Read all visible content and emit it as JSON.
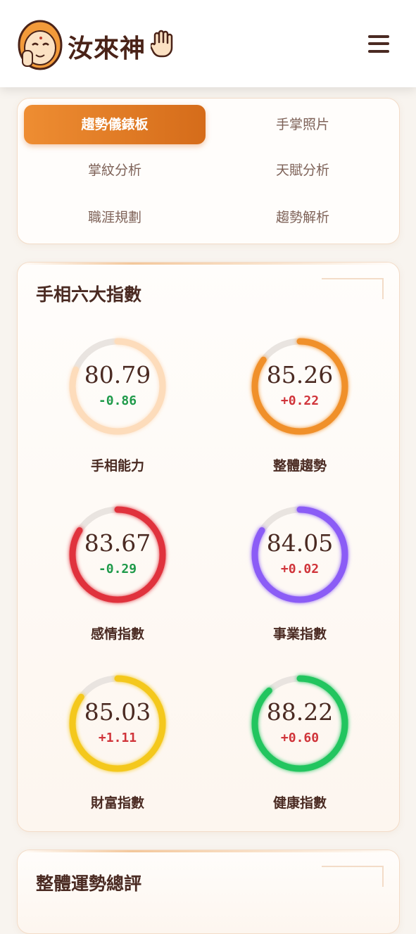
{
  "header": {
    "logo_text": "汝來神",
    "menu_icon": "hamburger-menu-icon"
  },
  "tabs": [
    {
      "label": "趨勢儀錶板",
      "active": true
    },
    {
      "label": "手掌照片",
      "active": false
    },
    {
      "label": "掌紋分析",
      "active": false
    },
    {
      "label": "天賦分析",
      "active": false
    },
    {
      "label": "職涯規劃",
      "active": false
    },
    {
      "label": "趨勢解析",
      "active": false
    }
  ],
  "indices": {
    "title": "手相六大指數",
    "items": [
      {
        "label": "手相能力",
        "value": "80.79",
        "delta": "-0.86",
        "progress": 0.81,
        "color": "#fddcbb",
        "delta_color": "#1f9a4a"
      },
      {
        "label": "整體趨勢",
        "value": "85.26",
        "delta": "+0.22",
        "progress": 0.85,
        "color": "#f0902a",
        "delta_color": "#d0343a"
      },
      {
        "label": "感情指數",
        "value": "83.67",
        "delta": "-0.29",
        "progress": 0.84,
        "color": "#e0333d",
        "delta_color": "#1f9a4a"
      },
      {
        "label": "事業指數",
        "value": "84.05",
        "delta": "+0.02",
        "progress": 0.84,
        "color": "#8b5cf6",
        "delta_color": "#d0343a"
      },
      {
        "label": "財富指數",
        "value": "85.03",
        "delta": "+1.11",
        "progress": 0.85,
        "color": "#f4c81c",
        "delta_color": "#d0343a"
      },
      {
        "label": "健康指數",
        "value": "88.22",
        "delta": "+0.60",
        "progress": 0.88,
        "color": "#22c55e",
        "delta_color": "#d0343a"
      }
    ]
  },
  "summary": {
    "title": "整體運勢總評"
  }
}
